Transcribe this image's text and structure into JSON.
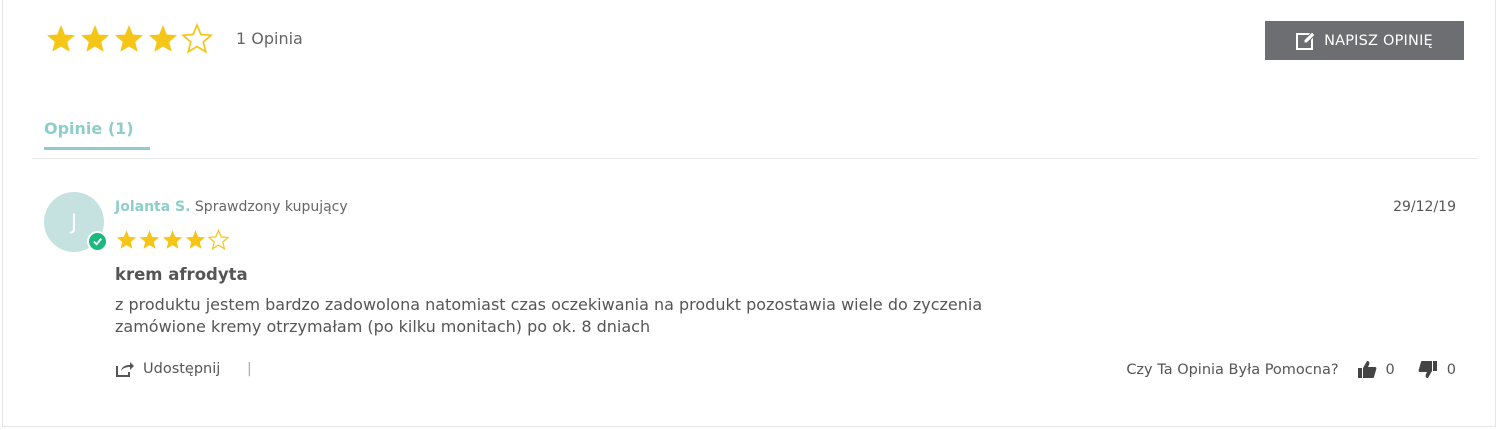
{
  "summary": {
    "rating": 4,
    "max_rating": 5,
    "count_label": "1 Opinia"
  },
  "toolbar": {
    "write_review_label": "NAPISZ OPINIĘ"
  },
  "tabs": [
    {
      "label": "Opinie (1)",
      "active": true
    }
  ],
  "review": {
    "avatar_initial": "J",
    "author_name": "Jolanta S.",
    "author_badge": "Sprawdzony kupujący",
    "date": "29/12/19",
    "rating": 4,
    "title": "krem afrodyta",
    "body_lines": [
      "z produktu jestem bardzo zadowolona natomiast czas oczekiwania na produkt pozostawia wiele do zyczenia",
      "zamówione kremy otrzymałam (po kilku monitach) po ok. 8 dniach"
    ],
    "share_label": "Udostępnij",
    "separator": "|",
    "helpful_question": "Czy Ta Opinia Była Pomocna?",
    "votes_up": "0",
    "votes_down": "0"
  },
  "colors": {
    "star": "#f5c518",
    "accent": "#8ecdcb",
    "button": "#6c6e72",
    "verified": "#1ab97e"
  },
  "icons": {
    "write": "pencil-square-icon",
    "share": "share-icon",
    "thumbs_up": "thumbs-up-icon",
    "thumbs_down": "thumbs-down-icon",
    "verified": "check-circle-icon"
  }
}
